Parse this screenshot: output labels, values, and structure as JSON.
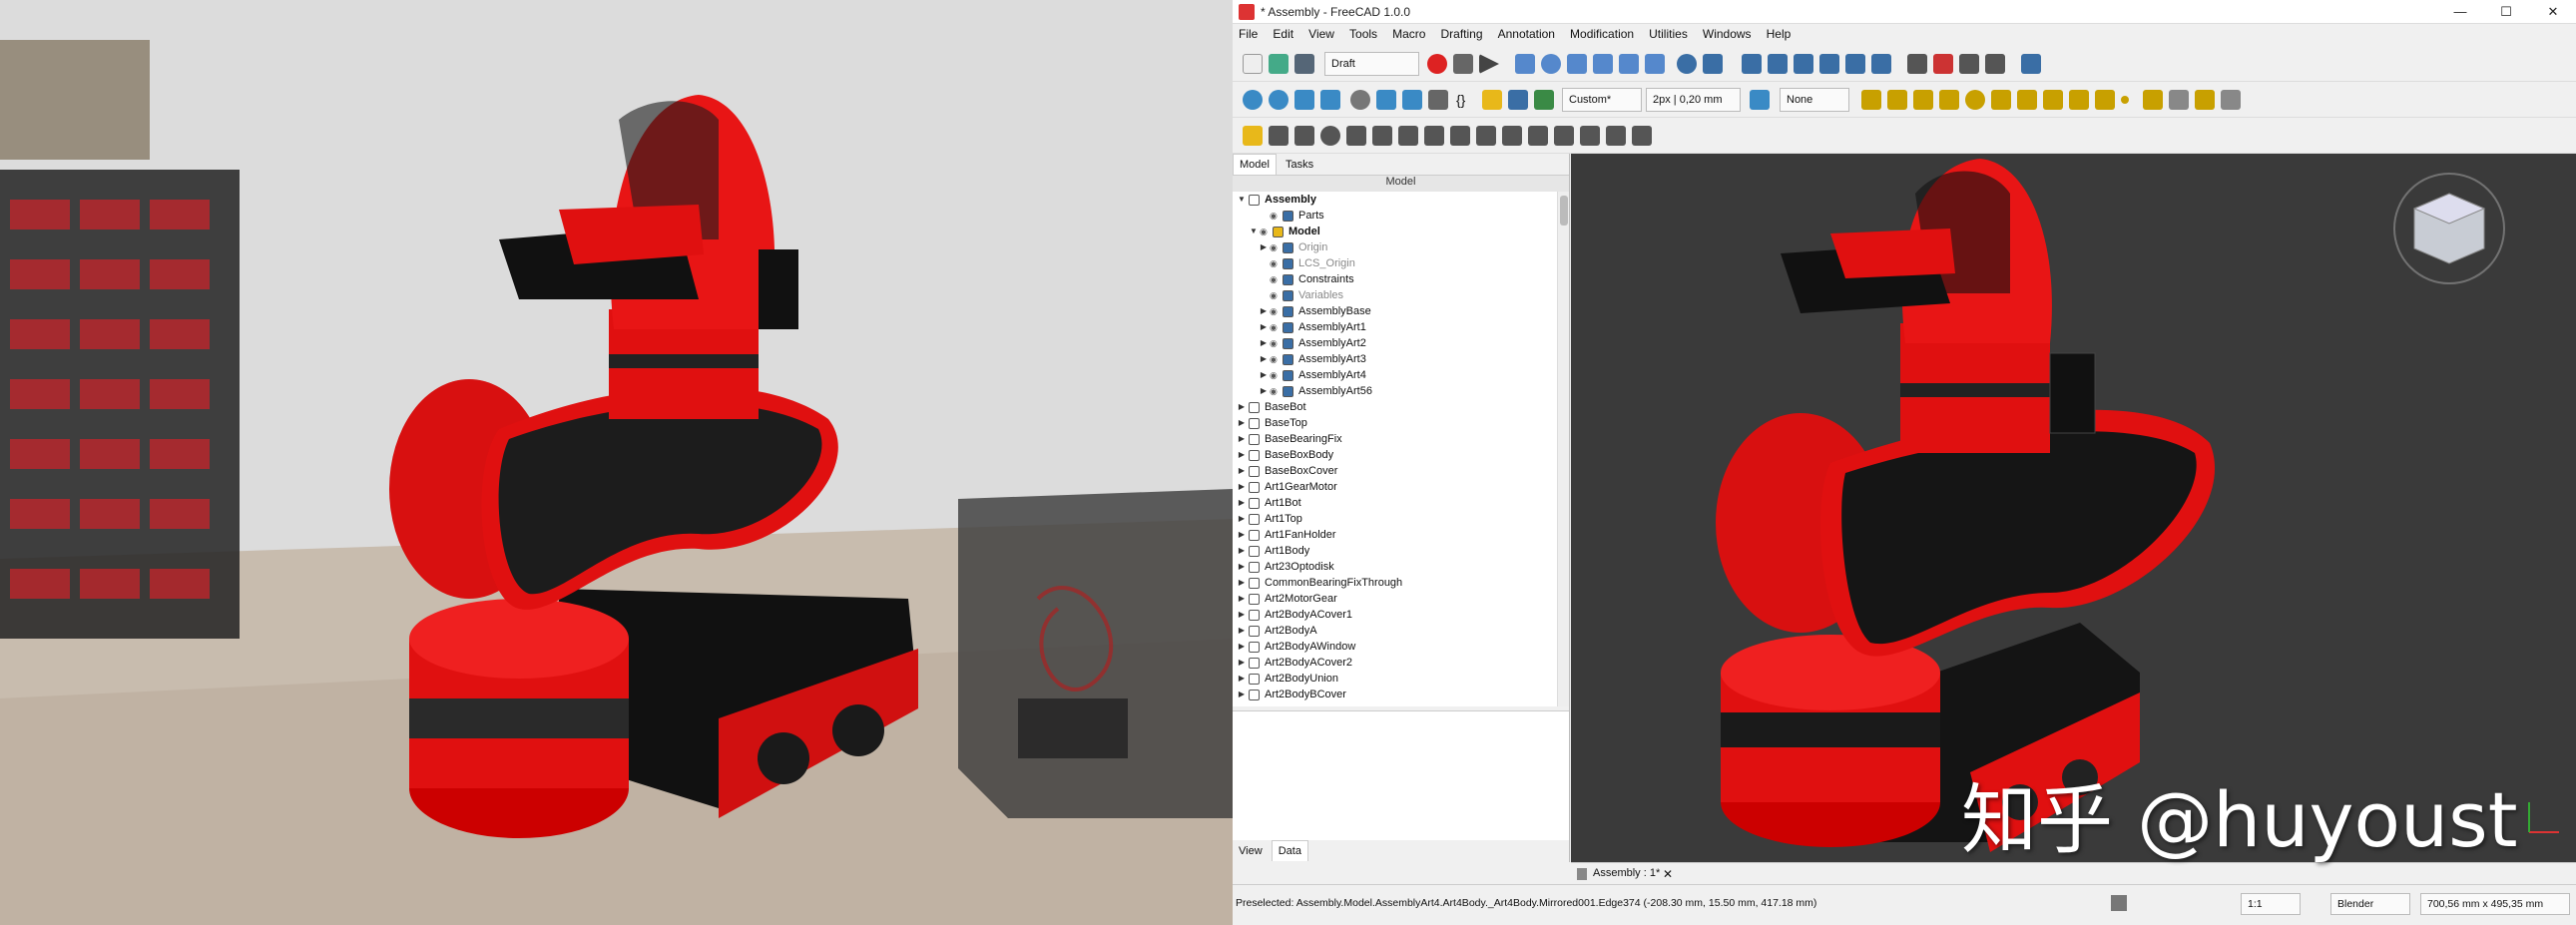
{
  "window": {
    "title": "* Assembly - FreeCAD 1.0.0",
    "minimize": "—",
    "maximize": "☐",
    "close": "✕"
  },
  "menu": [
    "File",
    "Edit",
    "View",
    "Tools",
    "Macro",
    "Drafting",
    "Annotation",
    "Modification",
    "Utilities",
    "Windows",
    "Help"
  ],
  "toolbar": {
    "workbench": "Draft",
    "style": "Custom*",
    "line_width": "2px | 0,20 mm",
    "snap": "None"
  },
  "dock": {
    "tabs": [
      "Model",
      "Tasks"
    ],
    "header": "Model",
    "bottom_tabs": [
      "View",
      "Data"
    ]
  },
  "tree": [
    {
      "label": "Assembly",
      "level": 0,
      "arrow": "▼",
      "bold": true
    },
    {
      "label": "Parts",
      "level": 2,
      "arrow": ""
    },
    {
      "label": "Model",
      "level": 1,
      "arrow": "▼",
      "bold": true
    },
    {
      "label": "Origin",
      "level": 2,
      "arrow": "▶",
      "dim": true
    },
    {
      "label": "LCS_Origin",
      "level": 2,
      "arrow": "",
      "dim": true
    },
    {
      "label": "Constraints",
      "level": 2,
      "arrow": ""
    },
    {
      "label": "Variables",
      "level": 2,
      "arrow": "",
      "dim": true
    },
    {
      "label": "AssemblyBase",
      "level": 2,
      "arrow": "▶"
    },
    {
      "label": "AssemblyArt1",
      "level": 2,
      "arrow": "▶"
    },
    {
      "label": "AssemblyArt2",
      "level": 2,
      "arrow": "▶"
    },
    {
      "label": "AssemblyArt3",
      "level": 2,
      "arrow": "▶"
    },
    {
      "label": "AssemblyArt4",
      "level": 2,
      "arrow": "▶"
    },
    {
      "label": "AssemblyArt56",
      "level": 2,
      "arrow": "▶"
    },
    {
      "label": "BaseBot",
      "level": 0,
      "arrow": "▶"
    },
    {
      "label": "BaseTop",
      "level": 0,
      "arrow": "▶"
    },
    {
      "label": "BaseBearingFix",
      "level": 0,
      "arrow": "▶"
    },
    {
      "label": "BaseBoxBody",
      "level": 0,
      "arrow": "▶"
    },
    {
      "label": "BaseBoxCover",
      "level": 0,
      "arrow": "▶"
    },
    {
      "label": "Art1GearMotor",
      "level": 0,
      "arrow": "▶"
    },
    {
      "label": "Art1Bot",
      "level": 0,
      "arrow": "▶"
    },
    {
      "label": "Art1Top",
      "level": 0,
      "arrow": "▶"
    },
    {
      "label": "Art1FanHolder",
      "level": 0,
      "arrow": "▶"
    },
    {
      "label": "Art1Body",
      "level": 0,
      "arrow": "▶"
    },
    {
      "label": "Art23Optodisk",
      "level": 0,
      "arrow": "▶"
    },
    {
      "label": "CommonBearingFixThrough",
      "level": 0,
      "arrow": "▶"
    },
    {
      "label": "Art2MotorGear",
      "level": 0,
      "arrow": "▶"
    },
    {
      "label": "Art2BodyACover1",
      "level": 0,
      "arrow": "▶"
    },
    {
      "label": "Art2BodyA",
      "level": 0,
      "arrow": "▶"
    },
    {
      "label": "Art2BodyAWindow",
      "level": 0,
      "arrow": "▶"
    },
    {
      "label": "Art2BodyACover2",
      "level": 0,
      "arrow": "▶"
    },
    {
      "label": "Art2BodyUnion",
      "level": 0,
      "arrow": "▶"
    },
    {
      "label": "Art2BodyBCover",
      "level": 0,
      "arrow": "▶"
    }
  ],
  "doc_tab": "Assembly : 1*",
  "status": {
    "message": "Preselected: Assembly.Model.AssemblyArt4.Art4Body._Art4Body.Mirrored001.Edge374 (-208.30 mm, 15.50 mm, 417.18 mm)",
    "zoom": "1:1",
    "nav": "Blender",
    "dims": "700,56 mm x 495,35 mm"
  },
  "watermark": "知乎 @huyoust",
  "colors": {
    "robot_red": "#e01010",
    "robot_black": "#1a1a1a",
    "viewport_bg": "#3a3a3a"
  }
}
